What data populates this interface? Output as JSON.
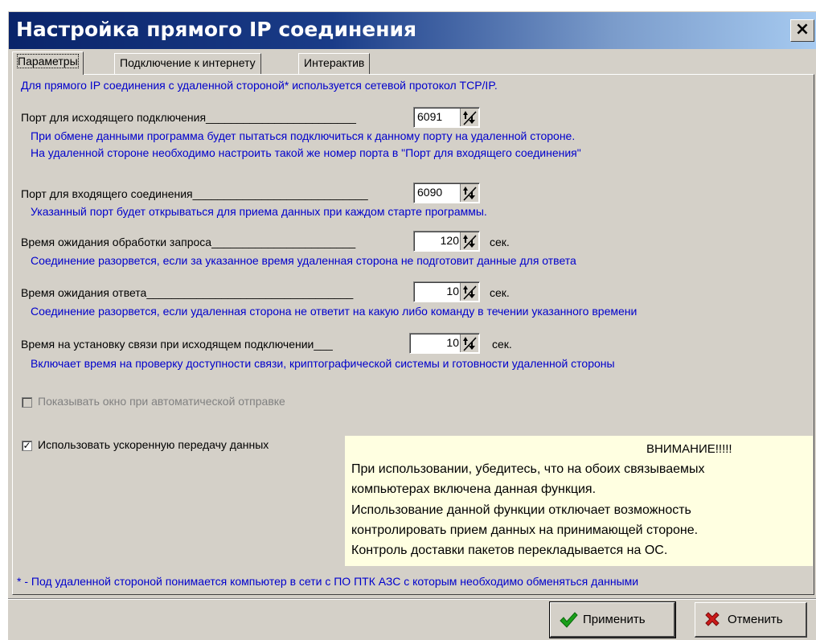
{
  "window": {
    "title": "Настройка прямого IP соединения",
    "close_label": "×"
  },
  "tabs": [
    {
      "label": "Параметры",
      "active": true
    },
    {
      "label": "Подключение к интернету",
      "active": false
    },
    {
      "label": "Интерактив",
      "active": false
    }
  ],
  "intro": "Для прямого IP соединения с удаленной стороной* используется сетевой протокол TCP/IP.",
  "outgoing_port": {
    "label": "Порт для исходящего подключения________________________",
    "value": "6091",
    "hint1": "При обмене данными программа будет пытаться подключиться к данному порту на удаленной стороне.",
    "hint2": "На удаленной стороне необходимо настроить такой же номер порта в \"Порт для входящего соединения\""
  },
  "incoming_port": {
    "label": "Порт для входящего соединения____________________________",
    "value": "6090",
    "hint": "Указанный порт будет открываться для приема данных при каждом старте программы."
  },
  "request_timeout": {
    "label": "Время ожидания обработки запроса_______________________",
    "value": "120",
    "unit": "сек.",
    "hint": "Соединение разорвется, если за указанное время удаленная сторона не подготовит данные для ответа"
  },
  "response_timeout": {
    "label": "Время ожидания ответа_________________________________",
    "value": "10",
    "unit": "сек.",
    "hint": "Соединение разорвется, если удаленная сторона не ответит на какую либо команду в течении указанного времени"
  },
  "connect_timeout": {
    "label": "Время на установку связи при исходящем подключении___",
    "value": "10",
    "unit": "сек.",
    "hint": "Включает время на проверку доступности связи, криптографической системы и готовности удаленной стороны"
  },
  "show_window_checkbox": {
    "label": "Показывать окно при автоматической отправке",
    "checked": false,
    "enabled": false
  },
  "fast_transfer_checkbox": {
    "label": "Использовать ускоренную передачу данных",
    "checked": true,
    "mark": "✓"
  },
  "warning": {
    "title": "ВНИМАНИЕ!!!!!",
    "lines": [
      "При использовании, убедитесь, что на обоих связываемых",
      "компьютерах включена данная функция.",
      "Использование данной функции отключает возможность",
      "контролировать прием данных на принимающей стороне.",
      "Контроль доставки пакетов перекладывается на ОС."
    ]
  },
  "footnote": "* - Под удаленной стороной понимается компьютер в сети с ПО ПТК АЗС с которым необходимо обменяться данными",
  "buttons": {
    "apply": {
      "label": "Применить",
      "icon": "checkmark-icon"
    },
    "cancel": {
      "label": "Отменить",
      "icon": "cross-icon"
    }
  },
  "colors": {
    "hint_text": "#0000cc",
    "title_bar": "#0a246a",
    "warning_bg": "#ffffe1"
  }
}
